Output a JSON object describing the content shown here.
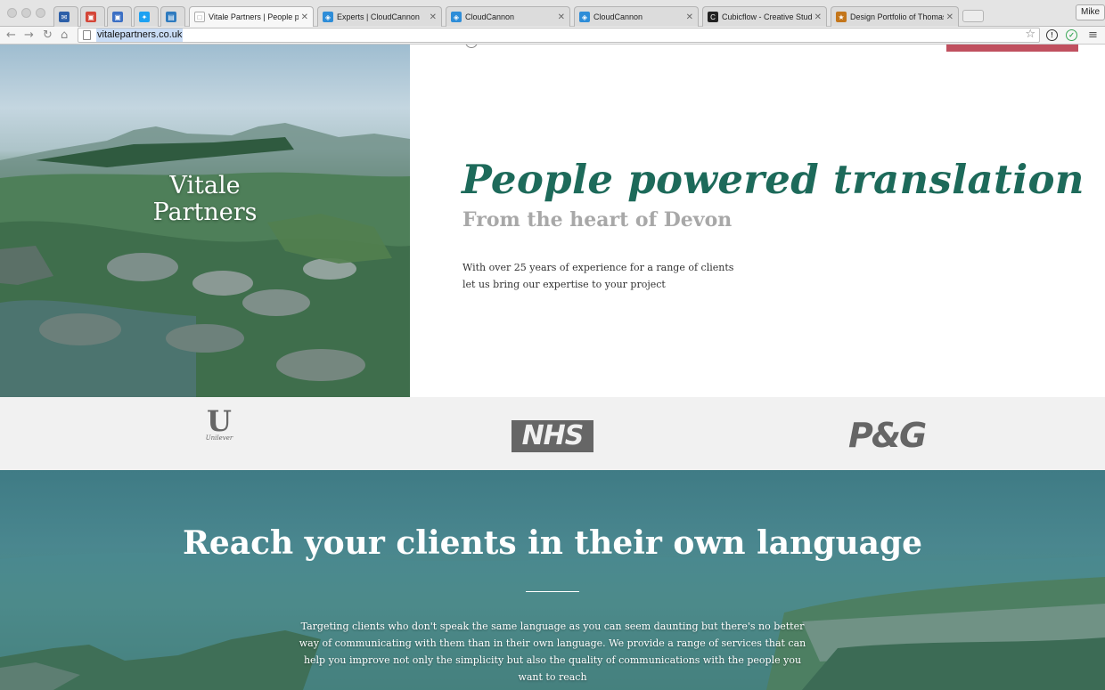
{
  "browser": {
    "tabs": [
      {
        "title": "",
        "favicon_color": "#2d5fa8",
        "favicon_glyph": "✉"
      },
      {
        "title": "",
        "favicon_color": "#d44638",
        "favicon_glyph": "▣"
      },
      {
        "title": "",
        "favicon_color": "#3b6fc4",
        "favicon_glyph": "▣"
      },
      {
        "title": "",
        "favicon_color": "#1da1f2",
        "favicon_glyph": "✦"
      },
      {
        "title": "",
        "favicon_color": "#2f7bbf",
        "favicon_glyph": "▤"
      },
      {
        "title": "Vitale Partners | People po",
        "favicon_color": "#ffffff",
        "favicon_glyph": "□",
        "active": true
      },
      {
        "title": "Experts | CloudCannon",
        "favicon_color": "#2e8dd8",
        "favicon_glyph": "◈"
      },
      {
        "title": "CloudCannon",
        "favicon_color": "#2e8dd8",
        "favicon_glyph": "◈"
      },
      {
        "title": "CloudCannon",
        "favicon_color": "#2e8dd8",
        "favicon_glyph": "◈"
      },
      {
        "title": "Cubicflow - Creative Studio",
        "favicon_color": "#222222",
        "favicon_glyph": "C"
      },
      {
        "title": "Design Portfolio of Thomas",
        "favicon_color": "#c4761b",
        "favicon_glyph": "★"
      }
    ],
    "profile_name": "Mike",
    "url": "vitalepartners.co.uk"
  },
  "hero": {
    "brand_line1": "Vitale",
    "brand_line2": "Partners",
    "headline": "People powered translation",
    "subheadline": "From the heart of Devon",
    "intro_line1": "With over 25 years of experience for a range of clients",
    "intro_line2": "let us bring our expertise to your project"
  },
  "clients": {
    "unilever_mark": "U",
    "unilever_wordmark": "Unilever",
    "nhs": "NHS",
    "pg": "P&G"
  },
  "reach": {
    "title": "Reach your clients in their own language",
    "body": "Targeting clients who don't speak the same language as you can seem daunting but there's no better way of communicating with them than in their own language. We provide a range of services that can help you improve not only the simplicity but also the quality of communications with the people you want to reach"
  },
  "colors": {
    "headline": "#1d6a5a",
    "subheadline": "#a8a8a8",
    "cta_bar": "#c0505f",
    "client_strip": "#f1f1f1",
    "logo_grey": "#666666"
  },
  "icons": {
    "back": "back-arrow-icon",
    "forward": "forward-arrow-icon",
    "reload": "reload-icon",
    "home": "home-icon",
    "bookmark": "star-icon",
    "menu": "hamburger-menu-icon"
  }
}
